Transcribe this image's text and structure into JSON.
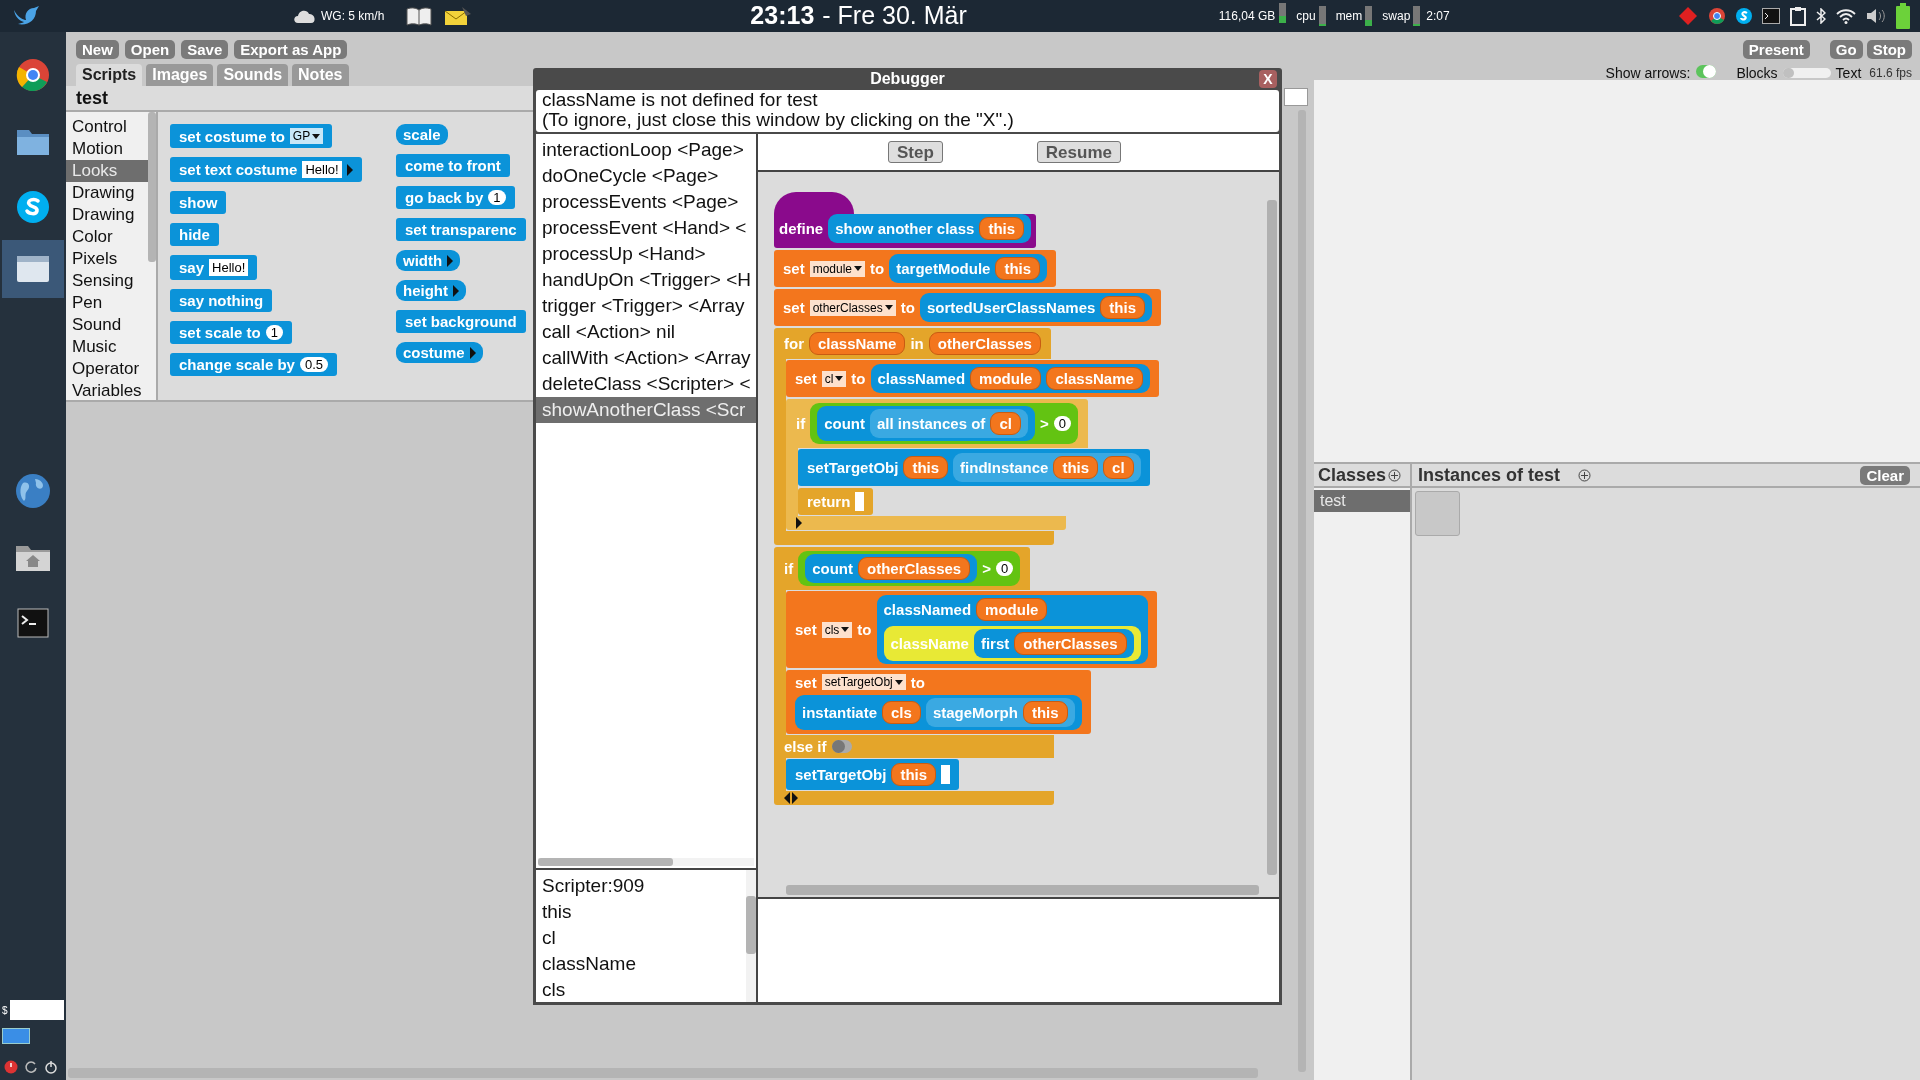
{
  "system_panel": {
    "weather": "WG: 5 km/h",
    "clock": {
      "time": "23:13",
      "date": "- Fre 30. Mär"
    },
    "disk": {
      "label": "116,04 GB",
      "level": 0.35
    },
    "meters": [
      {
        "label": "cpu",
        "level": 0.12
      },
      {
        "label": "mem",
        "level": 0.3
      },
      {
        "label": "swap",
        "level": 0.08
      }
    ],
    "uptime": "2:07"
  },
  "dock": {
    "items": [
      {
        "kind": "browser",
        "selected": false
      },
      {
        "kind": "folder",
        "selected": false
      },
      {
        "kind": "chat",
        "selected": false
      },
      {
        "kind": "window",
        "selected": true
      },
      {
        "kind": "globe",
        "selected": false
      },
      {
        "kind": "home",
        "selected": false
      },
      {
        "kind": "terminal",
        "selected": false
      }
    ],
    "prompt": "$"
  },
  "toolbar": {
    "buttons": [
      "New",
      "Open",
      "Save",
      "Export as App"
    ],
    "present": "Present",
    "run_buttons": [
      "Go",
      "Stop"
    ]
  },
  "tabs": [
    {
      "label": "Scripts",
      "selected": true
    },
    {
      "label": "Images",
      "selected": false
    },
    {
      "label": "Sounds",
      "selected": false
    },
    {
      "label": "Notes",
      "selected": false
    }
  ],
  "object_name": "test",
  "categories": [
    {
      "label": "Control",
      "selected": false
    },
    {
      "label": "Motion",
      "selected": false
    },
    {
      "label": "Looks",
      "selected": true
    },
    {
      "label": "Drawing",
      "selected": false
    },
    {
      "label": "Drawing",
      "selected": false
    },
    {
      "label": "Color",
      "selected": false
    },
    {
      "label": "Pixels",
      "selected": false
    },
    {
      "label": "Sensing",
      "selected": false
    },
    {
      "label": "Pen",
      "selected": false
    },
    {
      "label": "Sound",
      "selected": false
    },
    {
      "label": "Music",
      "selected": false
    },
    {
      "label": "Operator",
      "selected": false
    },
    {
      "label": "Variables",
      "selected": false
    }
  ],
  "palette": {
    "columns": [
      [
        {
          "kind": "command",
          "color": "#0b93d9",
          "parts": [
            {
              "kind": "label",
              "text": "set costume to"
            },
            {
              "kind": "dropdown",
              "text": "GP"
            }
          ]
        },
        {
          "kind": "command",
          "color": "#0b93d9",
          "parts": [
            {
              "kind": "label",
              "text": "set text costume"
            },
            {
              "kind": "slot",
              "text": "Hello!"
            },
            {
              "kind": "right_arrow"
            }
          ]
        },
        {
          "kind": "command",
          "color": "#0b93d9",
          "parts": [
            {
              "kind": "label",
              "text": "show"
            }
          ]
        },
        {
          "kind": "command",
          "color": "#0b93d9",
          "parts": [
            {
              "kind": "label",
              "text": "hide"
            }
          ]
        },
        {
          "kind": "command",
          "color": "#0b93d9",
          "parts": [
            {
              "kind": "label",
              "text": "say"
            },
            {
              "kind": "slot",
              "text": "Hello!"
            }
          ]
        },
        {
          "kind": "command",
          "color": "#0b93d9",
          "parts": [
            {
              "kind": "label",
              "text": "say nothing"
            }
          ]
        },
        {
          "kind": "command",
          "color": "#0b93d9",
          "parts": [
            {
              "kind": "label",
              "text": "set scale to"
            },
            {
              "kind": "number",
              "text": "1"
            }
          ]
        },
        {
          "kind": "command",
          "color": "#0b93d9",
          "parts": [
            {
              "kind": "label",
              "text": "change scale by"
            },
            {
              "kind": "number",
              "text": "0.5"
            }
          ]
        }
      ],
      [
        {
          "kind": "reporter",
          "color": "#0b93d9",
          "parts": [
            {
              "kind": "label",
              "text": "scale"
            }
          ]
        },
        {
          "kind": "command",
          "color": "#0b93d9",
          "parts": [
            {
              "kind": "label",
              "text": "come to front"
            }
          ]
        },
        {
          "kind": "command",
          "color": "#0b93d9",
          "parts": [
            {
              "kind": "label",
              "text": "go back by"
            },
            {
              "kind": "number",
              "text": "1"
            }
          ]
        },
        {
          "kind": "command",
          "color": "#0b93d9",
          "parts": [
            {
              "kind": "label",
              "text": "set transparenc"
            }
          ]
        },
        {
          "kind": "reporter",
          "color": "#0b93d9",
          "parts": [
            {
              "kind": "label",
              "text": "width"
            },
            {
              "kind": "right_arrow"
            }
          ]
        },
        {
          "kind": "reporter",
          "color": "#0b93d9",
          "parts": [
            {
              "kind": "label",
              "text": "height"
            },
            {
              "kind": "right_arrow"
            }
          ]
        },
        {
          "kind": "command",
          "color": "#0b93d9",
          "parts": [
            {
              "kind": "label",
              "text": "set background"
            }
          ]
        },
        {
          "kind": "reporter",
          "color": "#0b93d9",
          "parts": [
            {
              "kind": "label",
              "text": "costume"
            },
            {
              "kind": "right_arrow"
            }
          ]
        }
      ]
    ]
  },
  "stage_controls": {
    "show_arrows": {
      "label": "Show arrows:",
      "on": true
    },
    "slider": {
      "left": "Blocks",
      "right": "Text",
      "level": 0.03
    },
    "fps": "61.6 fps"
  },
  "classes": {
    "title": "Classes",
    "items": [
      {
        "label": "test",
        "selected": true
      }
    ]
  },
  "instances": {
    "title": "Instances of test",
    "clear": "Clear",
    "items": [
      {
        "kind": "blank"
      }
    ]
  },
  "debugger": {
    "title": "Debugger",
    "close": "X",
    "message": [
      "className is not defined for test",
      "(To ignore, just close this window by clicking on the \"X\".)"
    ],
    "stack": [
      {
        "label": "interactionLoop <Page>",
        "selected": false
      },
      {
        "label": "doOneCycle <Page>",
        "selected": false
      },
      {
        "label": "processEvents <Page>",
        "selected": false
      },
      {
        "label": "processEvent <Hand> <",
        "selected": false
      },
      {
        "label": "processUp <Hand>",
        "selected": false
      },
      {
        "label": "handUpOn <Trigger> <H",
        "selected": false
      },
      {
        "label": "trigger <Trigger> <Array",
        "selected": false
      },
      {
        "label": "call <Action> nil",
        "selected": false
      },
      {
        "label": "callWith <Action> <Array",
        "selected": false
      },
      {
        "label": "deleteClass <Scripter> <",
        "selected": false
      },
      {
        "label": "showAnotherClass <Scr",
        "selected": true
      }
    ],
    "variables": [
      "Scripter:909",
      "this",
      "cl",
      "className",
      "cls"
    ],
    "buttons": [
      "Step",
      "Resume"
    ],
    "script": [
      {
        "kind": "hat",
        "color": "#8a0a8c",
        "parts": [
          {
            "kind": "label",
            "text": "define"
          },
          {
            "kind": "reporter",
            "color": "#0b93d9",
            "parts": [
              {
                "kind": "label",
                "text": "show another class"
              },
              {
                "kind": "var",
                "text": "this"
              }
            ]
          }
        ]
      },
      {
        "kind": "command",
        "color": "#f3761d",
        "parts": [
          {
            "kind": "label",
            "text": "set"
          },
          {
            "kind": "dropdown",
            "text": "module"
          },
          {
            "kind": "label",
            "text": "to"
          },
          {
            "kind": "reporter",
            "color": "#0b93d9",
            "parts": [
              {
                "kind": "label",
                "text": "targetModule"
              },
              {
                "kind": "var",
                "text": "this"
              }
            ]
          }
        ]
      },
      {
        "kind": "command",
        "color": "#f3761d",
        "parts": [
          {
            "kind": "label",
            "text": "set"
          },
          {
            "kind": "dropdown",
            "text": "otherClasses"
          },
          {
            "kind": "label",
            "text": "to"
          },
          {
            "kind": "reporter",
            "color": "#0b93d9",
            "parts": [
              {
                "kind": "label",
                "text": "sortedUserClassNames"
              },
              {
                "kind": "var",
                "text": "this"
              }
            ]
          }
        ]
      },
      {
        "kind": "c",
        "color": "#e4a52a",
        "parts": [
          {
            "kind": "label",
            "text": "for"
          },
          {
            "kind": "var",
            "text": "className"
          },
          {
            "kind": "label",
            "text": "in"
          },
          {
            "kind": "var",
            "text": "otherClasses"
          }
        ],
        "children": [
          {
            "kind": "command",
            "color": "#f3761d",
            "parts": [
              {
                "kind": "label",
                "text": "set"
              },
              {
                "kind": "dropdown",
                "text": "cl"
              },
              {
                "kind": "label",
                "text": "to"
              },
              {
                "kind": "reporter",
                "color": "#0b93d9",
                "parts": [
                  {
                    "kind": "label",
                    "text": "classNamed"
                  },
                  {
                    "kind": "var",
                    "text": "module"
                  },
                  {
                    "kind": "var",
                    "text": "className"
                  }
                ]
              }
            ]
          },
          {
            "kind": "c",
            "color": "#ecb94e",
            "parts": [
              {
                "kind": "label",
                "text": "if"
              },
              {
                "kind": "reporter",
                "color": "#63c312",
                "parts": [
                  {
                    "kind": "reporter",
                    "color": "#0b93d9",
                    "parts": [
                      {
                        "kind": "label",
                        "text": "count"
                      },
                      {
                        "kind": "reporter",
                        "color": "#3aa9e2",
                        "parts": [
                          {
                            "kind": "label",
                            "text": "all instances of"
                          },
                          {
                            "kind": "var",
                            "text": "cl"
                          }
                        ]
                      }
                    ]
                  },
                  {
                    "kind": "label",
                    "text": ">"
                  },
                  {
                    "kind": "number",
                    "text": "0"
                  }
                ]
              }
            ],
            "children": [
              {
                "kind": "command",
                "color": "#0b93d9",
                "parts": [
                  {
                    "kind": "label",
                    "text": "setTargetObj"
                  },
                  {
                    "kind": "var",
                    "text": "this"
                  },
                  {
                    "kind": "reporter",
                    "color": "#3aa9e2",
                    "parts": [
                      {
                        "kind": "label",
                        "text": "findInstance"
                      },
                      {
                        "kind": "var",
                        "text": "this"
                      },
                      {
                        "kind": "var",
                        "text": "cl"
                      }
                    ]
                  }
                ]
              },
              {
                "kind": "command",
                "color": "#e4a52a",
                "parts": [
                  {
                    "kind": "label",
                    "text": "return"
                  },
                  {
                    "kind": "empty"
                  }
                ]
              }
            ],
            "footer": [
              {
                "kind": "right_arrow"
              }
            ]
          }
        ]
      },
      {
        "kind": "c",
        "color": "#e4a52a",
        "parts": [
          {
            "kind": "label",
            "text": "if"
          },
          {
            "kind": "reporter",
            "color": "#63c312",
            "parts": [
              {
                "kind": "reporter",
                "color": "#0b93d9",
                "parts": [
                  {
                    "kind": "label",
                    "text": "count"
                  },
                  {
                    "kind": "var",
                    "text": "otherClasses"
                  }
                ]
              },
              {
                "kind": "label",
                "text": ">"
              },
              {
                "kind": "number",
                "text": "0"
              }
            ]
          }
        ],
        "children": [
          {
            "kind": "command",
            "color": "#f3761d",
            "parts": [
              {
                "kind": "label",
                "text": "set"
              },
              {
                "kind": "dropdown",
                "text": "cls"
              },
              {
                "kind": "label",
                "text": "to"
              },
              {
                "kind": "reporter",
                "color": "#0b93d9",
                "parts": [
                  {
                    "kind": "label",
                    "text": "classNamed"
                  },
                  {
                    "kind": "var",
                    "text": "module"
                  },
                  {
                    "kind": "break"
                  },
                  {
                    "kind": "reporter",
                    "color": "#e8e935",
                    "parts": [
                      {
                        "kind": "label",
                        "text": "className"
                      },
                      {
                        "kind": "reporter",
                        "color": "#0b93d9",
                        "parts": [
                          {
                            "kind": "label",
                            "text": "first"
                          },
                          {
                            "kind": "var",
                            "text": "otherClasses"
                          }
                        ]
                      }
                    ]
                  }
                ]
              }
            ]
          },
          {
            "kind": "command",
            "color": "#f3761d",
            "parts": [
              {
                "kind": "label",
                "text": "set"
              },
              {
                "kind": "dropdown",
                "text": "setTargetObj"
              },
              {
                "kind": "label",
                "text": "to"
              },
              {
                "kind": "break"
              },
              {
                "kind": "reporter",
                "color": "#0b93d9",
                "parts": [
                  {
                    "kind": "label",
                    "text": "instantiate"
                  },
                  {
                    "kind": "var",
                    "text": "cls"
                  },
                  {
                    "kind": "reporter",
                    "color": "#3aa9e2",
                    "parts": [
                      {
                        "kind": "label",
                        "text": "stageMorph"
                      },
                      {
                        "kind": "var",
                        "text": "this"
                      }
                    ]
                  }
                ]
              }
            ]
          }
        ],
        "else_parts": [
          {
            "kind": "label",
            "text": "else if"
          },
          {
            "kind": "toggle",
            "on": false
          }
        ],
        "else_children": [
          {
            "kind": "command",
            "color": "#0b93d9",
            "parts": [
              {
                "kind": "label",
                "text": "setTargetObj"
              },
              {
                "kind": "var",
                "text": "this"
              },
              {
                "kind": "empty"
              }
            ]
          }
        ],
        "footer": [
          {
            "kind": "double_arrow"
          }
        ]
      }
    ]
  }
}
